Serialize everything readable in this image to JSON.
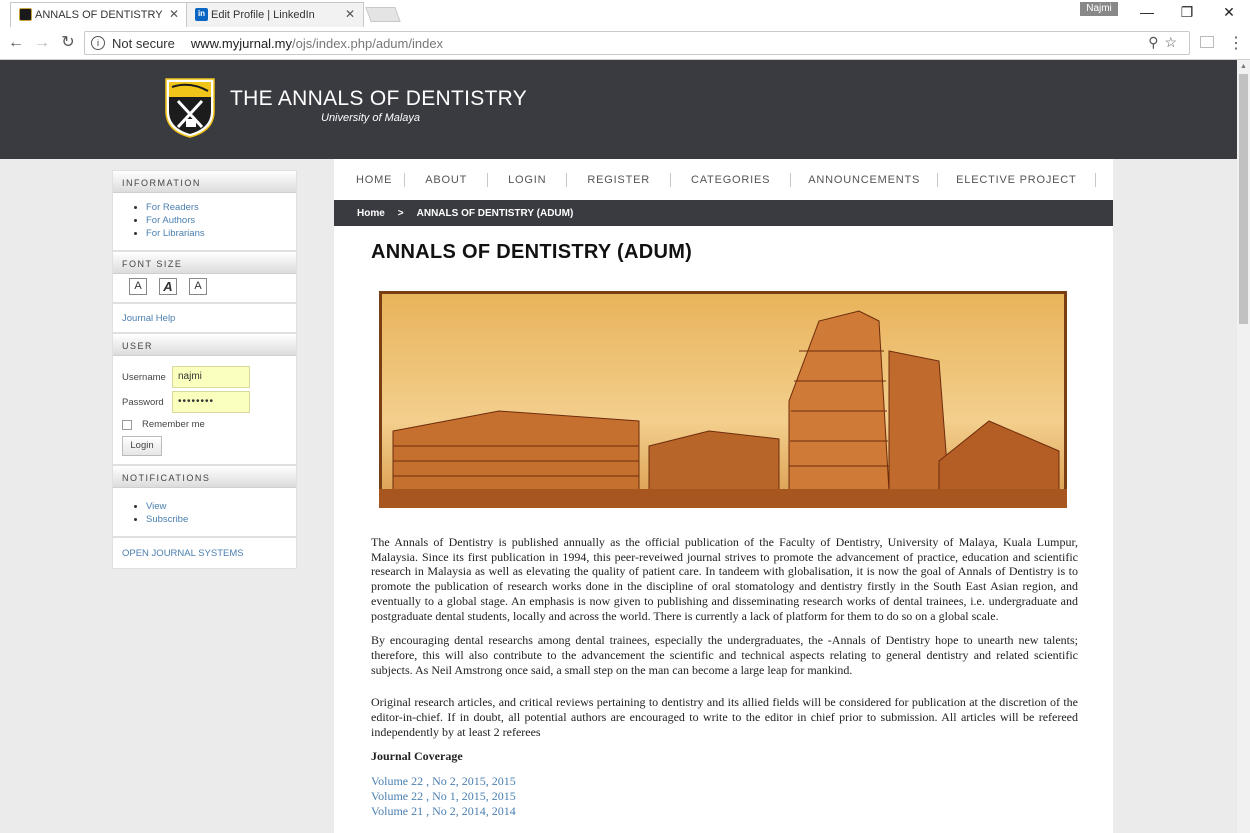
{
  "browser": {
    "tabs": [
      {
        "title": "ANNALS OF DENTISTRY (",
        "active": true
      },
      {
        "title": "Edit Profile | LinkedIn",
        "active": false
      }
    ],
    "profile_name": "Najmi",
    "security_label": "Not secure",
    "url_host": "www.myjurnal.my",
    "url_path": "/ojs/index.php/adum/index"
  },
  "site": {
    "title": "THE ANNALS OF DENTISTRY",
    "subtitle": "University of Malaya"
  },
  "sidebar": {
    "information": {
      "heading": "INFORMATION",
      "links": [
        "For Readers",
        "For Authors",
        "For Librarians"
      ]
    },
    "font_size": {
      "heading": "FONT SIZE",
      "buttons": [
        "A",
        "A",
        "A"
      ]
    },
    "journal_help": "Journal Help",
    "user": {
      "heading": "USER",
      "username_label": "Username",
      "username_value": "najmi",
      "password_label": "Password",
      "password_value": "••••••••",
      "remember_label": "Remember me",
      "login_label": "Login"
    },
    "notifications": {
      "heading": "NOTIFICATIONS",
      "links": [
        "View",
        "Subscribe"
      ]
    },
    "ojs_link": "OPEN JOURNAL SYSTEMS"
  },
  "nav": {
    "items": [
      "HOME",
      "ABOUT",
      "LOGIN",
      "REGISTER",
      "CATEGORIES",
      "ANNOUNCEMENTS",
      "ELECTIVE PROJECT"
    ]
  },
  "breadcrumb": {
    "home": "Home",
    "separator": ">",
    "current": "ANNALS OF DENTISTRY (ADUM)"
  },
  "page": {
    "title": "ANNALS OF DENTISTRY (ADUM)",
    "paragraphs": [
      "The Annals of Dentistry is published annually as the official publication of the Faculty of Dentistry, University of Malaya, Kuala Lumpur, Malaysia. Since its first publication in 1994, this peer-reveiwed journal strives to promote the advancement of practice, education and scientific research in Malaysia as well as elevating the quality of patient care. In tandeem with globalisation, it is now the goal of Annals of Dentistry is to promote the publication of research works done in the discipline of oral stomatology and dentistry firstly in the South East Asian region, and eventually to a global stage. An emphasis is now given to publishing and disseminating research works of dental trainees, i.e. undergraduate and postgraduate dental students, locally and across the world. There is currently a lack of platform for them to do so on a global scale.",
      "By encouraging dental researchs among dental trainees, especially the undergraduates, the -Annals of Dentistry hope to unearth new talents; therefore, this will also contribute to the advancement the scientific and technical aspects relating to general dentistry and related scientific subjects. As Neil Amstrong once said, a small step on the man can become a large leap for mankind.",
      "Original research articles, and critical reviews pertaining to dentistry and its allied fields will be considered for publication at the discretion of the editor-in-chief. If in doubt, all potential authors are encouraged to write to the editor in chief prior to submission. All articles will be refereed independently by at least 2 referees"
    ],
    "coverage_heading": "Journal Coverage",
    "volumes": [
      "Volume 22 , No 2, 2015, 2015",
      "Volume 22 , No 1, 2015, 2015",
      "Volume 21 , No 2, 2014, 2014"
    ]
  },
  "colors": {
    "header_bg": "#3a3b40",
    "link": "#4a7fb0",
    "autofill": "#faffbd"
  }
}
